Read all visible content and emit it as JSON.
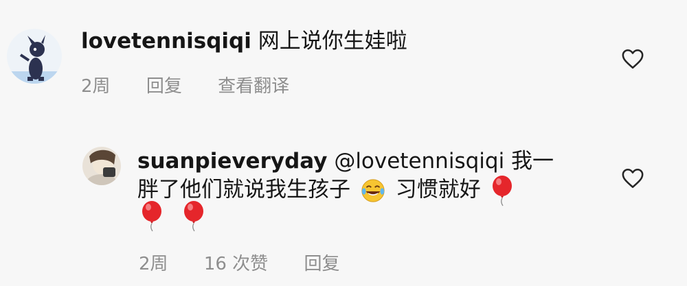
{
  "colors": {
    "background": "#f7f7f7",
    "text": "#161616",
    "meta": "#8e8e8e",
    "balloon": "#e5262b",
    "emoji": "#f7c531"
  },
  "comments": [
    {
      "username": "lovetennisqiqi",
      "text": "网上说你生娃啦",
      "meta": {
        "time": "2周",
        "reply": "回复",
        "translate": "查看翻译"
      },
      "icon": "heart-outline-icon"
    },
    {
      "username": "suanpieveryday",
      "mention": "@lovetennisqiqi",
      "text_line1": "我一",
      "text_line2_a": "胖了他们就说我生孩子",
      "emoji_name": "laughing-tears-emoji",
      "text_line2_b": "习惯就好",
      "balloon_name": "red-balloon-emoji",
      "meta": {
        "time": "2周",
        "likes": "16 次赞",
        "reply": "回复"
      },
      "icon": "heart-outline-icon"
    }
  ]
}
